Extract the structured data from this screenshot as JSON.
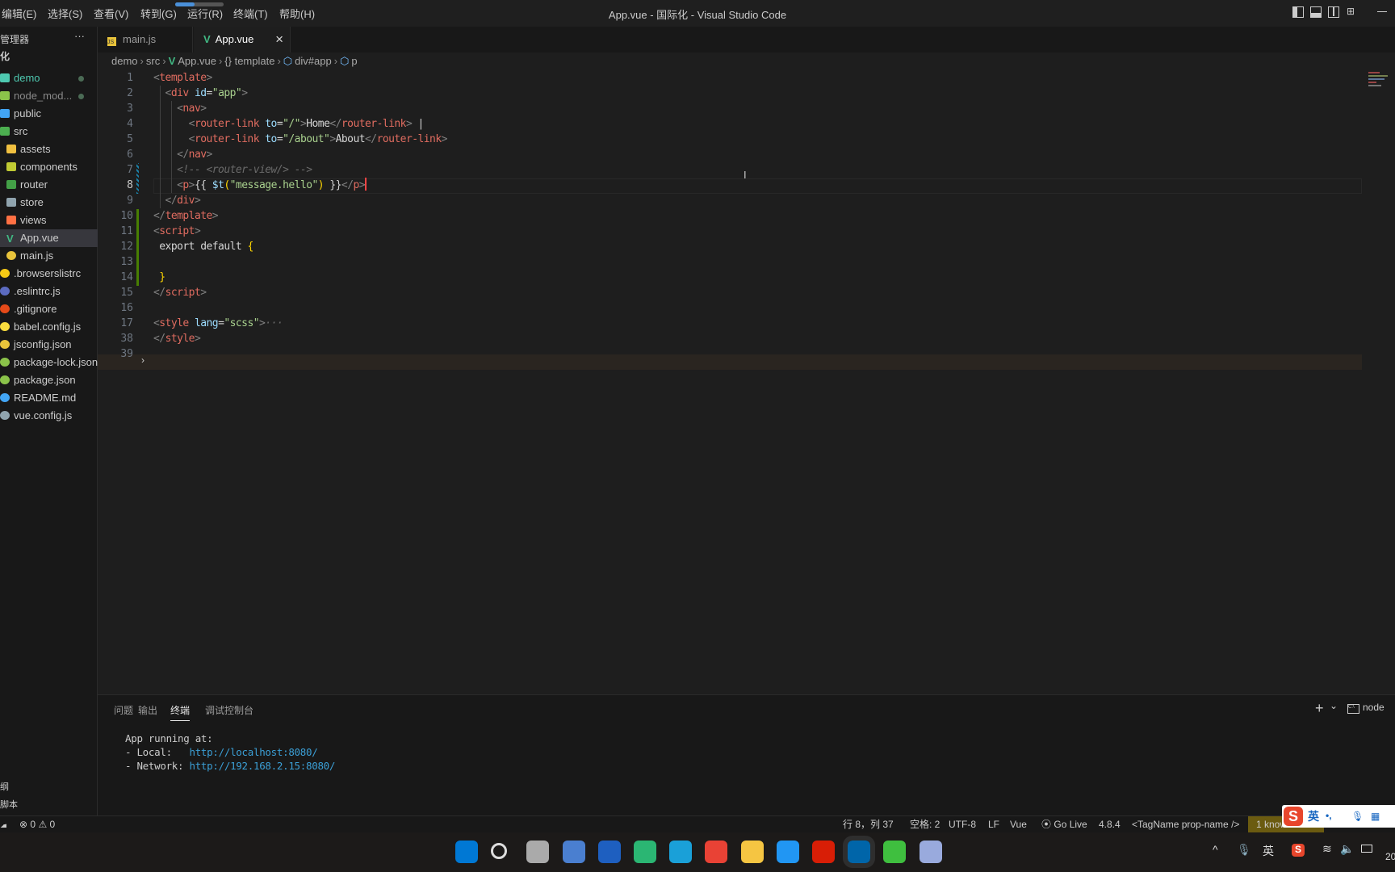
{
  "window": {
    "title": "App.vue - 国际化 - Visual Studio Code"
  },
  "menu": [
    "编辑(E)",
    "选择(S)",
    "查看(V)",
    "转到(G)",
    "运行(R)",
    "终端(T)",
    "帮助(H)"
  ],
  "sidebar": {
    "title": "管理器",
    "more": "···",
    "root_label": "化",
    "items": [
      {
        "label": "demo",
        "color": "#4ec9b0",
        "icon": "folder-open-icon",
        "dot": true,
        "indent": 0
      },
      {
        "label": "node_mod...",
        "color": "#8a8a8a",
        "icon": "node-folder-icon",
        "dot": true,
        "indent": 0
      },
      {
        "label": "public",
        "color": "#ccc",
        "icon": "public-folder-icon",
        "indent": 0
      },
      {
        "label": "src",
        "color": "#ccc",
        "icon": "src-folder-icon",
        "indent": 0
      },
      {
        "label": "assets",
        "color": "#ccc",
        "icon": "assets-folder-icon",
        "indent": 1
      },
      {
        "label": "components",
        "color": "#ccc",
        "icon": "components-folder-icon",
        "indent": 1
      },
      {
        "label": "router",
        "color": "#ccc",
        "icon": "router-folder-icon",
        "indent": 1
      },
      {
        "label": "store",
        "color": "#ccc",
        "icon": "store-folder-icon",
        "indent": 1
      },
      {
        "label": "views",
        "color": "#ccc",
        "icon": "views-folder-icon",
        "indent": 1
      },
      {
        "label": "App.vue",
        "color": "#ccc",
        "icon": "vue-icon",
        "indent": 1,
        "selected": true
      },
      {
        "label": "main.js",
        "color": "#ccc",
        "icon": "js-icon",
        "indent": 1
      },
      {
        "label": ".browserslistrc",
        "color": "#ccc",
        "icon": "browserslist-icon",
        "indent": 0
      },
      {
        "label": ".eslintrc.js",
        "color": "#ccc",
        "icon": "eslint-icon",
        "indent": 0
      },
      {
        "label": ".gitignore",
        "color": "#ccc",
        "icon": "git-icon",
        "indent": 0
      },
      {
        "label": "babel.config.js",
        "color": "#ccc",
        "icon": "babel-icon",
        "indent": 0
      },
      {
        "label": "jsconfig.json",
        "color": "#ccc",
        "icon": "jsconfig-icon",
        "indent": 0
      },
      {
        "label": "package-lock.json",
        "color": "#ccc",
        "icon": "npm-icon",
        "indent": 0
      },
      {
        "label": "package.json",
        "color": "#ccc",
        "icon": "npm-icon",
        "indent": 0
      },
      {
        "label": "README.md",
        "color": "#ccc",
        "icon": "info-icon",
        "indent": 0
      },
      {
        "label": "vue.config.js",
        "color": "#ccc",
        "icon": "vue-config-icon",
        "indent": 0
      }
    ],
    "bottom": [
      "纲",
      "脚本"
    ]
  },
  "tabs": [
    {
      "label": "main.js",
      "icon": "js-icon"
    },
    {
      "label": "App.vue",
      "icon": "vue-icon",
      "active": true,
      "close": "×"
    }
  ],
  "breadcrumb": [
    "demo",
    "src",
    "App.vue",
    "{} template",
    "div#app",
    "p"
  ],
  "editor": {
    "lines": [
      {
        "n": "1",
        "tokens": [
          [
            "<",
            "tag"
          ],
          [
            "template",
            "tn"
          ],
          [
            ">",
            "tag"
          ]
        ]
      },
      {
        "n": "2",
        "tokens": [
          [
            "  <",
            "tag"
          ],
          [
            "div ",
            "tn"
          ],
          [
            "id",
            "attr"
          ],
          [
            "=",
            "txt"
          ],
          [
            "\"app\"",
            "str"
          ],
          [
            ">",
            "tag"
          ]
        ]
      },
      {
        "n": "3",
        "tokens": [
          [
            "    <",
            "tag"
          ],
          [
            "nav",
            "tn"
          ],
          [
            ">",
            "tag"
          ]
        ]
      },
      {
        "n": "4",
        "tokens": [
          [
            "      <",
            "tag"
          ],
          [
            "router-link ",
            "tn"
          ],
          [
            "to",
            "attr"
          ],
          [
            "=",
            "txt"
          ],
          [
            "\"/\"",
            "str"
          ],
          [
            ">",
            "tag"
          ],
          [
            "Home",
            "txt"
          ],
          [
            "</",
            "tag"
          ],
          [
            "router-link",
            "tn"
          ],
          [
            ">",
            "tag"
          ],
          [
            " |",
            "txt"
          ]
        ]
      },
      {
        "n": "5",
        "tokens": [
          [
            "      <",
            "tag"
          ],
          [
            "router-link ",
            "tn"
          ],
          [
            "to",
            "attr"
          ],
          [
            "=",
            "txt"
          ],
          [
            "\"/about\"",
            "str"
          ],
          [
            ">",
            "tag"
          ],
          [
            "About",
            "txt"
          ],
          [
            "</",
            "tag"
          ],
          [
            "router-link",
            "tn"
          ],
          [
            ">",
            "tag"
          ]
        ]
      },
      {
        "n": "6",
        "tokens": [
          [
            "    </",
            "tag"
          ],
          [
            "nav",
            "tn"
          ],
          [
            ">",
            "tag"
          ]
        ]
      },
      {
        "n": "7",
        "tokens": [
          [
            "    <!-- <router-view/> -->",
            "cmt"
          ]
        ]
      },
      {
        "n": "8",
        "current": true,
        "tokens": [
          [
            "    <",
            "tag"
          ],
          [
            "p",
            "tn"
          ],
          [
            ">",
            "tag"
          ],
          [
            "{{ ",
            "txt"
          ],
          [
            "$t",
            "var"
          ],
          [
            "(",
            "fn"
          ],
          [
            "\"message.hello\"",
            "str"
          ],
          [
            ")",
            "fn"
          ],
          [
            " }}",
            "txt"
          ],
          [
            "</",
            "tag"
          ],
          [
            "p",
            "tn"
          ],
          [
            ">",
            "tag"
          ]
        ]
      },
      {
        "n": "9",
        "tokens": [
          [
            "  </",
            "tag"
          ],
          [
            "div",
            "tn"
          ],
          [
            ">",
            "tag"
          ]
        ]
      },
      {
        "n": "10",
        "tokens": [
          [
            "</",
            "tag"
          ],
          [
            "template",
            "tn"
          ],
          [
            ">",
            "tag"
          ]
        ]
      },
      {
        "n": "11",
        "tokens": [
          [
            "<",
            "tag"
          ],
          [
            "script",
            "tn"
          ],
          [
            ">",
            "tag"
          ]
        ]
      },
      {
        "n": "12",
        "tokens": [
          [
            " export default ",
            "kw"
          ],
          [
            "{",
            "brace"
          ]
        ]
      },
      {
        "n": "13",
        "tokens": []
      },
      {
        "n": "14",
        "tokens": [
          [
            " }",
            "brace"
          ]
        ]
      },
      {
        "n": "15",
        "tokens": [
          [
            "</",
            "tag"
          ],
          [
            "script",
            "tn"
          ],
          [
            ">",
            "tag"
          ]
        ]
      },
      {
        "n": "16",
        "tokens": []
      },
      {
        "n": "17",
        "folded": true,
        "tokens": [
          [
            "<",
            "tag"
          ],
          [
            "style ",
            "tn"
          ],
          [
            "lang",
            "attr"
          ],
          [
            "=",
            "txt"
          ],
          [
            "\"scss\"",
            "str"
          ],
          [
            ">",
            "tag"
          ],
          [
            "···",
            "cmt"
          ]
        ]
      },
      {
        "n": "38",
        "tokens": [
          [
            "</",
            "tag"
          ],
          [
            "style",
            "tn"
          ],
          [
            ">",
            "tag"
          ]
        ]
      },
      {
        "n": "39",
        "tokens": []
      }
    ]
  },
  "panel": {
    "tabs": [
      "问题",
      "输出",
      "终端",
      "调试控制台"
    ],
    "active": 2,
    "add": "+",
    "dropdown": "⌄",
    "shell": "node",
    "terminal": [
      {
        "text": "App running at:"
      },
      {
        "text": "- Local:   ",
        "url": "http://localhost:8080/"
      },
      {
        "text": "- Network: ",
        "url": "http://192.168.2.15:8080/"
      }
    ]
  },
  "statusbar": {
    "errors": "0",
    "warnings": "0",
    "position": "行 8，列 37",
    "spaces": "空格: 2",
    "encoding": "UTF-8",
    "eol": "LF",
    "language": "Vue",
    "golive": "Go Live",
    "version": "4.8.4",
    "snippet": "<TagName prop-name />",
    "issue": "1 known issue"
  },
  "ime": {
    "logo": "S",
    "lang": "英",
    "punct": "•,"
  },
  "taskbar": {
    "icons": [
      "windows-start-icon",
      "search-icon",
      "task-view-icon",
      "app-icon",
      "lenovo-icon",
      "wechat-work-icon",
      "edge-icon",
      "chrome-icon",
      "file-explorer-icon",
      "baidu-netdisk-icon",
      "netease-music-icon",
      "vscode-icon",
      "wechat-icon",
      "app-icon-2"
    ],
    "tray": {
      "chevron": "^",
      "lang": "英",
      "clock": "20"
    }
  },
  "colors": {
    "accent": "#0078d4",
    "issue_bg": "#6b5b10",
    "vue_green": "#41b883"
  }
}
